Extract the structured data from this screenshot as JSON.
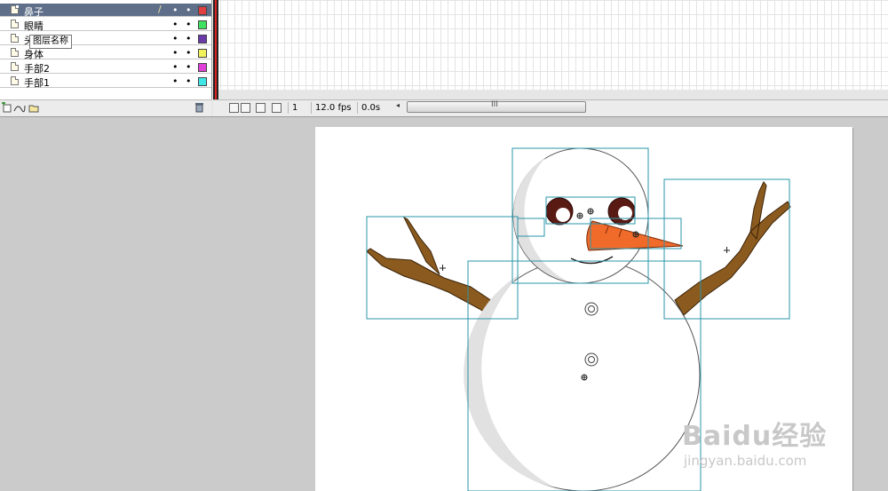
{
  "timeline": {
    "layers": [
      {
        "name": "鼻子",
        "selected": true,
        "color": "#e04040",
        "editing": true
      },
      {
        "name": "眼睛",
        "selected": false,
        "color": "#40e060"
      },
      {
        "name": "头",
        "selected": false,
        "color": "#6a3aa8"
      },
      {
        "name": "身体",
        "selected": false,
        "color": "#f2f25a"
      },
      {
        "name": "手部2",
        "selected": false,
        "color": "#e040d8"
      },
      {
        "name": "手部1",
        "selected": false,
        "color": "#3ee6e6"
      }
    ],
    "tooltip": "图层名称",
    "dot_glyph": "•",
    "status": {
      "frame": "1",
      "fps": "12.0 fps",
      "time": "0.0s",
      "scroll_grip": "III",
      "scroll_left_arrow": "◂"
    }
  },
  "watermark": {
    "main": "Baidu经验",
    "sub": "jingyan.baidu.com"
  },
  "colors": {
    "stage": "#ffffff",
    "pasteboard": "#cbcbcb",
    "branch": "#8b5a1e",
    "carrot": "#f06a2a",
    "eye": "#5a1a14",
    "bbox": "#2a94a8"
  }
}
